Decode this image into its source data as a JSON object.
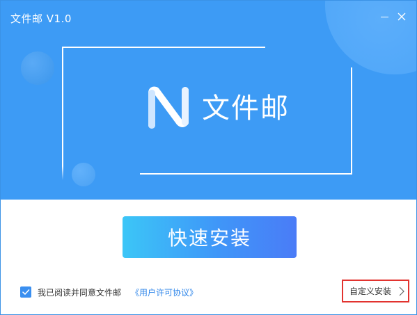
{
  "window": {
    "title": "文件邮 V1.0"
  },
  "banner": {
    "brand_name": "文件邮",
    "logo_icon": "n-logo-icon"
  },
  "actions": {
    "install_label": "快速安装",
    "agree_text": "我已阅读并同意文件邮",
    "license_link": "《用户许可协议》",
    "agree_checked": true,
    "custom_install_label": "自定义安装"
  },
  "colors": {
    "banner_blue": "#3d9bf5",
    "button_gradient_start": "#3cc6f7",
    "button_gradient_end": "#4a7cf7",
    "link_blue": "#2f86ea",
    "highlight_red": "#e2332f"
  }
}
